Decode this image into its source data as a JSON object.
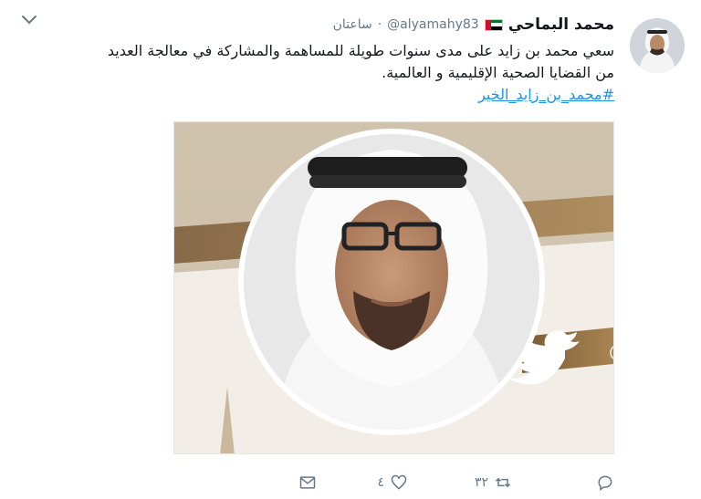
{
  "user": {
    "display_name": "محمد البماحي",
    "handle": "@alyamahy83",
    "timestamp": "ساعتان",
    "separator": "·"
  },
  "tweet": {
    "text_line1": "سعي محمد بن زايد على مدى سنوات طويلة للمساهمة والمشاركة في معالجة العديد",
    "text_line2": "من القضايا الصحية الإقليمية و العالمية.",
    "hashtag": "#محمد_بن_زايد_الخير"
  },
  "media": {
    "partial_text": "@"
  },
  "actions": {
    "reply_count": "",
    "retweet_count": "٣٢",
    "like_count": "٤",
    "message_count": ""
  },
  "colors": {
    "link": "#1b95e0",
    "secondary_text": "#657786",
    "flag_red": "#ce1126",
    "flag_green": "#00732f",
    "flag_black": "#000000"
  },
  "icons": {
    "caret": "chevron-down-icon",
    "reply": "reply-icon",
    "retweet": "retweet-icon",
    "like": "heart-icon",
    "message": "envelope-icon",
    "twitter": "twitter-bird-icon",
    "flag": "uae-flag-icon"
  }
}
